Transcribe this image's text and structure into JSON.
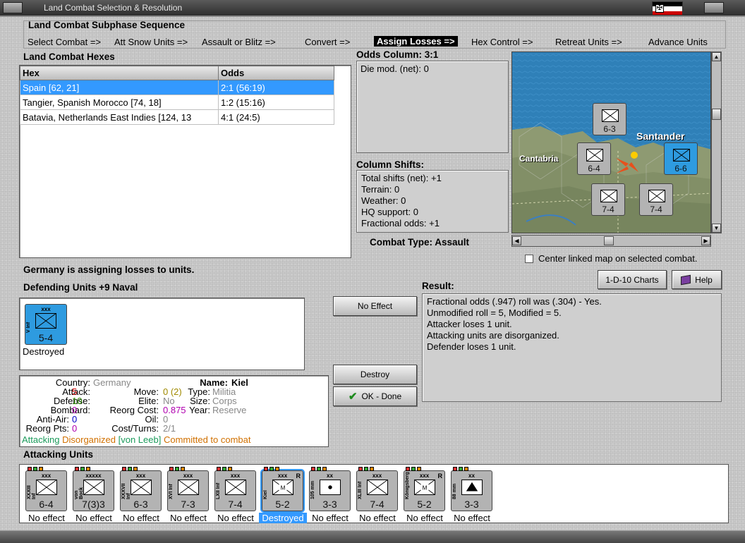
{
  "window": {
    "title": "Land Combat Selection & Resolution"
  },
  "subphase": {
    "header": "Land Combat Subphase Sequence",
    "steps": [
      "Select Combat =>",
      "Att Snow Units =>",
      "Assault or Blitz =>",
      "Convert =>",
      "Assign Losses =>",
      "Hex Control =>",
      "Retreat Units =>",
      "Advance Units"
    ],
    "active_index": 4
  },
  "hexes": {
    "header": "Land Combat Hexes",
    "columns": [
      "Hex",
      "Odds"
    ],
    "rows": [
      {
        "hex": "Spain [62, 21]",
        "odds": "2:1 (56:19)",
        "selected": true
      },
      {
        "hex": "Tangier, Spanish Morocco [74, 18]",
        "odds": "1:2 (15:16)",
        "selected": false
      },
      {
        "hex": "Batavia, Netherlands East Indies [124, 13",
        "odds": "4:1 (24:5)",
        "selected": false
      }
    ]
  },
  "odds": {
    "header": "Odds Column: 3:1",
    "die_mod": "Die mod. (net): 0"
  },
  "shifts": {
    "header": "Column Shifts:",
    "lines": [
      "Total shifts (net): +1",
      "Terrain: 0",
      "Weather: 0",
      "HQ support: 0",
      "Fractional odds: +1"
    ]
  },
  "combat_type": "Combat Type:  Assault",
  "map": {
    "labels": [
      "Cantabria",
      "Santander"
    ],
    "center_checkbox_label": "Center linked map on selected combat."
  },
  "status_message": "Germany is assigning losses to units.",
  "defending": {
    "header": "Defending Units +9 Naval",
    "units": [
      {
        "name": "V Inf",
        "size": "xxx",
        "value": "5-4",
        "status": "Destroyed"
      }
    ]
  },
  "buttons": {
    "no_effect": "No Effect",
    "destroy": "Destroy",
    "ok_done": "OK - Done",
    "charts": "1-D-10 Charts",
    "help": "Help"
  },
  "result": {
    "header": "Result:",
    "lines": [
      "Fractional odds (.947) roll was (.304)  - Yes.",
      "Unmodified roll = 5, Modified = 5.",
      "Attacker loses 1 unit.",
      "Attacking units are disorganized.",
      "Defender loses 1 unit."
    ]
  },
  "unit_info": {
    "country_k": "Country:",
    "country_v": "Germany",
    "attack_k": "Attack:",
    "attack_v": "5",
    "defense_k": "Defense:",
    "defense_v": "10",
    "bombard_k": "Bombard:",
    "bombard_v": "0",
    "antiair_k": "Anti-Air:",
    "antiair_v": "0",
    "reorg_k": "Reorg Pts:",
    "reorg_v": "0",
    "name_k": "Name:",
    "name_v": "Kiel",
    "move_k": "Move:",
    "move_v": "0 (2)",
    "elite_k": "Elite:",
    "elite_v": "No",
    "reorgcost_k": "Reorg Cost:",
    "reorgcost_v": "0.875",
    "oil_k": "Oil:",
    "oil_v": "0",
    "cost_k": "Cost/Turns:",
    "cost_v": "2/1",
    "type_k": "Type:",
    "type_v": "Militia",
    "size_k": "Size:",
    "size_v": "Corps",
    "year_k": "Year:",
    "year_v": "Reserve",
    "status1": "Attacking",
    "status2": "Disorganized",
    "status3": "[von Leeb]",
    "status4": "Committed to combat"
  },
  "attacking": {
    "header": "Attacking Units",
    "units": [
      {
        "name": "XXXIII Inf",
        "size": "xxx",
        "value": "6-4",
        "status": "No effect",
        "kind": "inf"
      },
      {
        "name": "von Bock",
        "size": "xxxxx",
        "value": "7(3)3",
        "status": "No effect",
        "kind": "inf"
      },
      {
        "name": "XXXVII Inf",
        "size": "xxx",
        "value": "6-3",
        "status": "No effect",
        "kind": "inf"
      },
      {
        "name": "XVI Inf",
        "size": "xxx",
        "value": "7-3",
        "status": "No effect",
        "kind": "inf"
      },
      {
        "name": "LXII Inf",
        "size": "xxx",
        "value": "7-4",
        "status": "No effect",
        "kind": "inf"
      },
      {
        "name": "Kiel",
        "size": "xxx",
        "value": "5-2",
        "status": "Destroyed",
        "kind": "mil"
      },
      {
        "name": "105 mm",
        "size": "xx",
        "value": "3-3",
        "status": "No effect",
        "kind": "art"
      },
      {
        "name": "XLIII Inf",
        "size": "xxx",
        "value": "7-4",
        "status": "No effect",
        "kind": "inf"
      },
      {
        "name": "Königsberg",
        "size": "xxx",
        "value": "5-2",
        "status": "No effect",
        "kind": "mil"
      },
      {
        "name": "88 mm",
        "size": "xx",
        "value": "3-3",
        "status": "No effect",
        "kind": "aa"
      }
    ]
  },
  "colors": {
    "selected": "#3399ff",
    "attack": "#d40000",
    "defense": "#2a8a00",
    "bombard": "#b000b0",
    "antiair": "#0000c8",
    "status_green": "#1a9a5a",
    "status_orange": "#d07000"
  }
}
